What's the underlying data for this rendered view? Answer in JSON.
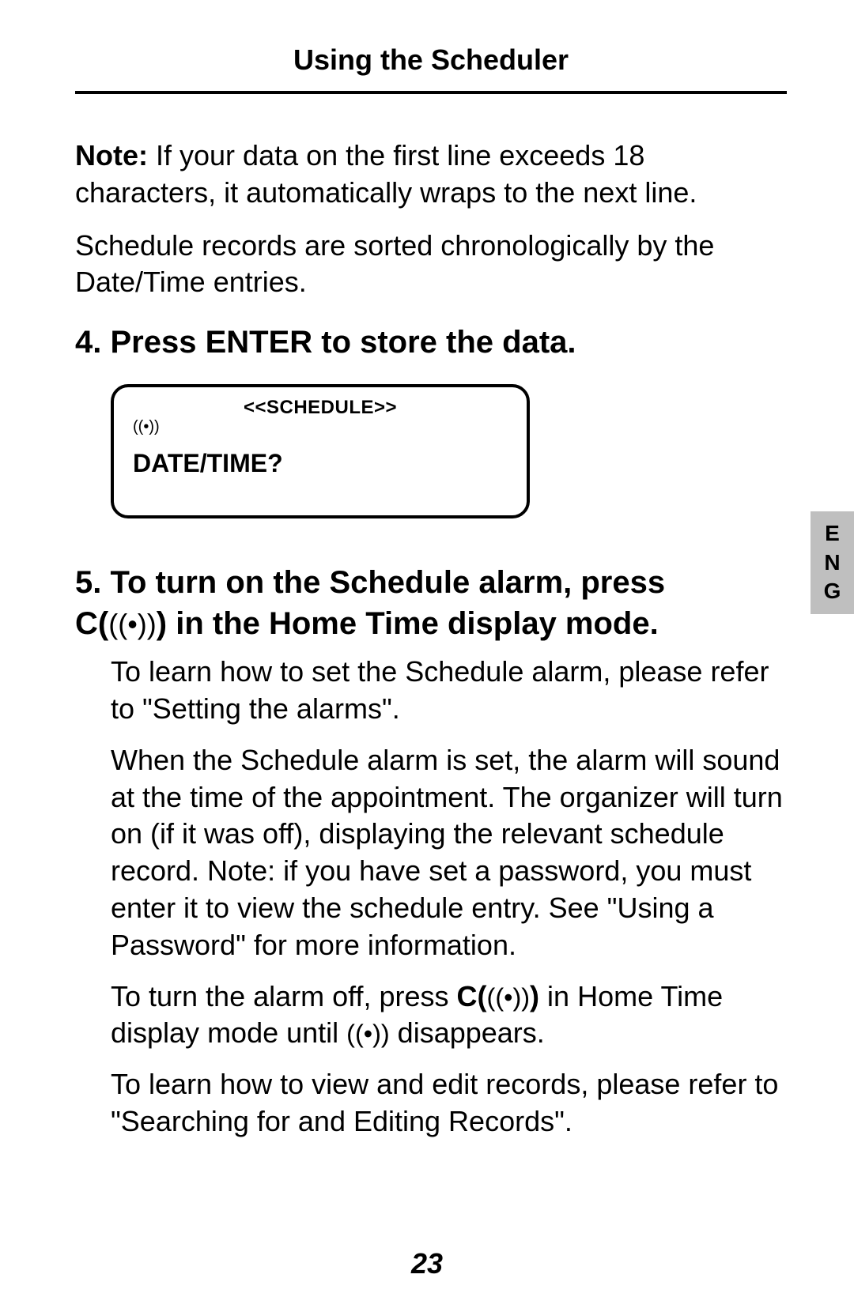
{
  "header": "Using the Scheduler",
  "note_label": "Note:",
  "note_text": " If your data on the first line exceeds 18 characters, it automatically wraps to the next line.",
  "para_sort": "Schedule records are sorted chronologically by the Date/Time entries.",
  "step4": "4. Press ENTER to store the data.",
  "screen": {
    "title": "<<SCHEDULE>>",
    "icon": "((•))",
    "prompt": "DATE/TIME?"
  },
  "side_tab": {
    "l1": "E",
    "l2": "N",
    "l3": "G"
  },
  "step5_line1": "5. To turn on the Schedule alarm, press",
  "step5_c": "C(",
  "step5_alarm_icon": "((•))",
  "step5_line2_rest": ") in the Home Time display mode.",
  "para_learn_set": "To learn how to set the Schedule alarm, please refer to \"Setting the alarms\".",
  "para_when_set": "When the Schedule alarm is set, the alarm will sound at the time of the appointment. The organizer will turn on (if it was off), displaying the relevant schedule record. Note: if you have set a password, you must enter it to view the schedule entry. See \"Using a Password\" for more information.",
  "para_off_pre": "To turn the alarm off, press ",
  "para_off_c": "C(",
  "para_off_icon": "((•))",
  "para_off_cend": ")",
  "para_off_mid": " in Home Time display mode until ",
  "para_off_icon2": "((•))",
  "para_off_end": " disappears.",
  "para_learn_view": "To learn how to view and edit records, please refer to \"Searching for and Editing Records\".",
  "page_num": "23"
}
